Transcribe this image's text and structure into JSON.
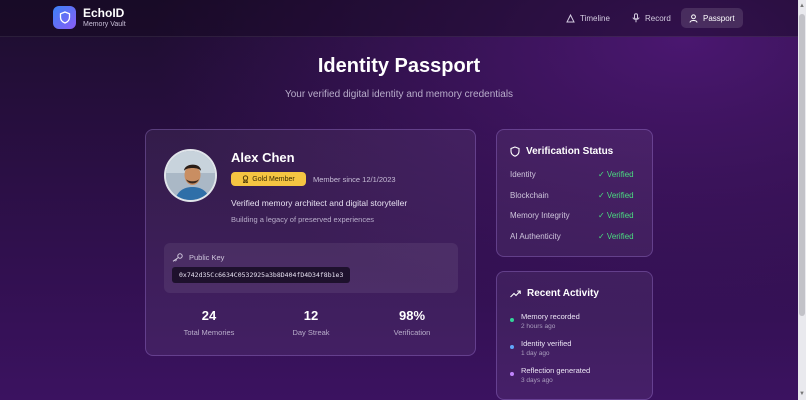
{
  "header": {
    "brand_name": "EchoID",
    "brand_sub": "Memory Vault",
    "nav": [
      {
        "label": "Timeline",
        "icon": "timeline-icon",
        "active": false
      },
      {
        "label": "Record",
        "icon": "microphone-icon",
        "active": false
      },
      {
        "label": "Passport",
        "icon": "user-icon",
        "active": true
      }
    ]
  },
  "page": {
    "title": "Identity Passport",
    "subtitle": "Your verified digital identity and memory credentials"
  },
  "profile": {
    "name": "Alex Chen",
    "badge": "Gold Member",
    "member_since": "Member since 12/1/2023",
    "bio": "Verified memory architect and digital storyteller",
    "tagline": "Building a legacy of preserved experiences",
    "public_key_label": "Public Key",
    "public_key": "0x742d35Cc6634C0532925a3b8D404fD4D34f8b1e3",
    "stats": [
      {
        "value": "24",
        "label": "Total Memories"
      },
      {
        "value": "12",
        "label": "Day Streak"
      },
      {
        "value": "98%",
        "label": "Verification"
      }
    ]
  },
  "verification": {
    "title": "Verification Status",
    "items": [
      {
        "label": "Identity",
        "status": "✓ Verified"
      },
      {
        "label": "Blockchain",
        "status": "✓ Verified"
      },
      {
        "label": "Memory Integrity",
        "status": "✓ Verified"
      },
      {
        "label": "AI Authenticity",
        "status": "✓ Verified"
      }
    ]
  },
  "activity": {
    "title": "Recent Activity",
    "items": [
      {
        "title": "Memory recorded",
        "time": "2 hours ago",
        "color": "#34d399"
      },
      {
        "title": "Identity verified",
        "time": "1 day ago",
        "color": "#60a5fa"
      },
      {
        "title": "Reflection generated",
        "time": "3 days ago",
        "color": "#c084fc"
      }
    ]
  },
  "colors": {
    "accent": "#8b5cf6",
    "badge": "#f5c542",
    "verified": "#4ade80"
  }
}
